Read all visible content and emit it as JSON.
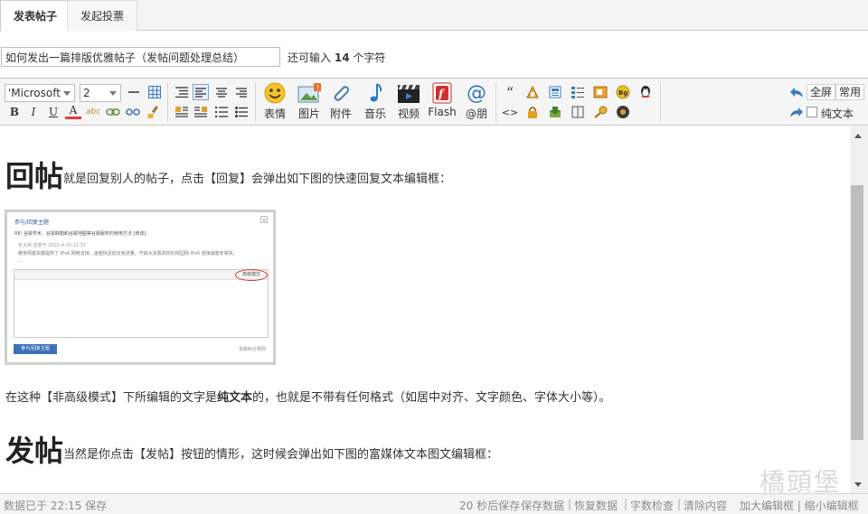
{
  "tabs": [
    {
      "label": "发表帖子",
      "active": true
    },
    {
      "label": "发起投票",
      "active": false
    }
  ],
  "title_row": {
    "value": "如何发出一篇排版优雅帖子（发帖问题处理总结）",
    "hint_prefix": "还可输入",
    "hint_count": "14",
    "hint_suffix": "个字符"
  },
  "toolbar": {
    "font_select": "'Microsoft",
    "size_select": "2",
    "bold": "B",
    "italic": "I",
    "underline": "U",
    "font_color": "A",
    "spell": "abc",
    "media_buttons": [
      "表情",
      "图片",
      "附件",
      "音乐",
      "视频",
      "Flash",
      "@朋"
    ],
    "quote": "“",
    "code": "<>",
    "fullscreen": "全屏",
    "common": "常用",
    "plain_text": "纯文本"
  },
  "content": {
    "heading1": "回帖",
    "para1": "就是回复别人的帖子，点击【回复】会弹出如下图的快速回复文本编辑框：",
    "para2_a": "在这种【非高级模式】下所编辑的文字是",
    "para2_b": "纯文本",
    "para2_c": "的，也就是不带有任何格式（如居中对齐、文字颜色、字体大小等）。",
    "heading2": "发帖",
    "para3": "当然是你点击【发帖】按钮的情形，这时候会弹出如下图的富媒体文本图文编辑框："
  },
  "embedded_shot": {
    "title": "参与/回复主题",
    "line1": "RE: 谷歌学术、谷歌邮箱和谷歌地图等谷歌服务的使用方法 [修改]",
    "line2": "张大侠 发表于 2015-4-20 21:37",
    "line3": "教育网基本都提供了 IPv6 网络支持，速度快且稳定免流量，开启大多数高校的校园网 IPv6 连接速度非常快，",
    "line4": "...",
    "adv_mode": "高级模式",
    "submit": "参与/回复主题",
    "footer": "本版积分规则"
  },
  "status": {
    "saved": "数据已于 22:15 保存",
    "autosave": "20 秒后保存",
    "save_data": "保存数据",
    "restore_data": "恢复数据",
    "word_check": "字数检查",
    "clear": "清除内容",
    "resize": "加大编辑框 | 缩小编辑框"
  },
  "watermark": "橋頭堡",
  "colors": {
    "accent": "#2b5fa6",
    "status_text": "#8c8c8c"
  }
}
